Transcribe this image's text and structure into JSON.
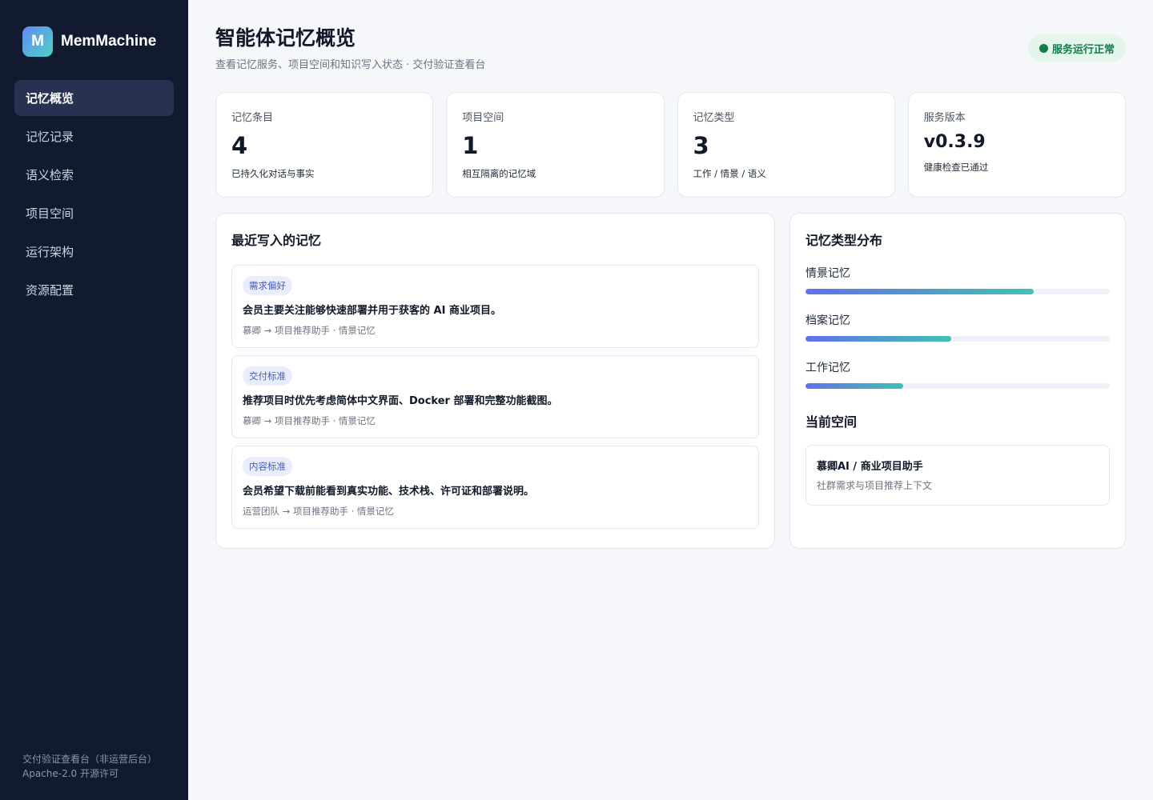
{
  "brand": {
    "logo_letter": "M",
    "name": "MemMachine"
  },
  "nav": [
    {
      "label": "记忆概览",
      "active": true
    },
    {
      "label": "记忆记录",
      "active": false
    },
    {
      "label": "语义检索",
      "active": false
    },
    {
      "label": "项目空间",
      "active": false
    },
    {
      "label": "运行架构",
      "active": false
    },
    {
      "label": "资源配置",
      "active": false
    }
  ],
  "sidebar_footer": {
    "line1": "交付验证查看台（非运营后台）",
    "line2": "Apache-2.0 开源许可"
  },
  "header": {
    "title": "智能体记忆概览",
    "subtitle": "查看记忆服务、项目空间和知识写入状态 · 交付验证查看台",
    "status": "服务运行正常"
  },
  "stats": [
    {
      "label": "记忆条目",
      "value": "4",
      "note": "已持久化对话与事实"
    },
    {
      "label": "项目空间",
      "value": "1",
      "note": "相互隔离的记忆域"
    },
    {
      "label": "记忆类型",
      "value": "3",
      "note": "工作 / 情景 / 语义"
    },
    {
      "label": "服务版本",
      "value": "v0.3.9",
      "note": "健康检查已通过"
    }
  ],
  "recent": {
    "title": "最近写入的记忆",
    "items": [
      {
        "tag": "需求偏好",
        "text": "会员主要关注能够快速部署并用于获客的 AI 商业项目。",
        "meta": "慕卿 → 项目推荐助手 · 情景记忆"
      },
      {
        "tag": "交付标准",
        "text": "推荐项目时优先考虑简体中文界面、Docker 部署和完整功能截图。",
        "meta": "慕卿 → 项目推荐助手 · 情景记忆"
      },
      {
        "tag": "内容标准",
        "text": "会员希望下载前能看到真实功能、技术栈、许可证和部署说明。",
        "meta": "运营团队 → 项目推荐助手 · 情景记忆"
      }
    ]
  },
  "distribution": {
    "title": "记忆类型分布",
    "items": [
      {
        "label": "情景记忆",
        "fraction": 0.75
      },
      {
        "label": "档案记忆",
        "fraction": 0.48
      },
      {
        "label": "工作记忆",
        "fraction": 0.32
      }
    ]
  },
  "current_space": {
    "title": "当前空间",
    "name": "慕卿AI / 商业项目助手",
    "desc": "社群需求与项目推荐上下文"
  },
  "colors": {
    "sidebar_bg": "#121a30",
    "accent_start": "#6171ea",
    "accent_end": "#3fc2b3",
    "status_green": "#177a4b"
  }
}
